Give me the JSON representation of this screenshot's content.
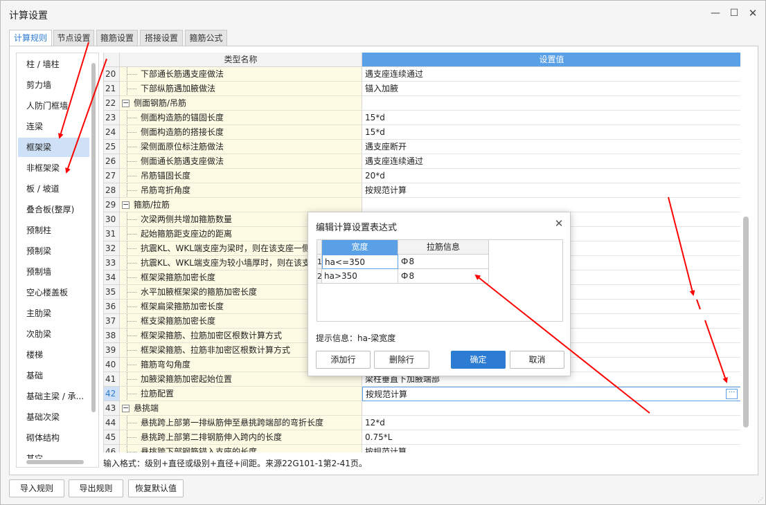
{
  "window": {
    "title": "计算设置",
    "min_glyph": "—",
    "max_glyph": "☐",
    "close_glyph": "✕"
  },
  "tabs": [
    {
      "label": "计算规则",
      "active": true
    },
    {
      "label": "节点设置",
      "active": false
    },
    {
      "label": "箍筋设置",
      "active": false
    },
    {
      "label": "搭接设置",
      "active": false
    },
    {
      "label": "箍筋公式",
      "active": false
    }
  ],
  "sidebar": {
    "items": [
      {
        "label": "柱 / 墙柱",
        "selected": false
      },
      {
        "label": "剪力墙",
        "selected": false
      },
      {
        "label": "人防门框墙",
        "selected": false
      },
      {
        "label": "连梁",
        "selected": false
      },
      {
        "label": "框架梁",
        "selected": true
      },
      {
        "label": "非框架梁",
        "selected": false
      },
      {
        "label": "板 / 坡道",
        "selected": false
      },
      {
        "label": "叠合板(整厚)",
        "selected": false
      },
      {
        "label": "预制柱",
        "selected": false
      },
      {
        "label": "预制梁",
        "selected": false
      },
      {
        "label": "预制墙",
        "selected": false
      },
      {
        "label": "空心楼盖板",
        "selected": false
      },
      {
        "label": "主肋梁",
        "selected": false
      },
      {
        "label": "次肋梁",
        "selected": false
      },
      {
        "label": "楼梯",
        "selected": false
      },
      {
        "label": "基础",
        "selected": false
      },
      {
        "label": "基础主梁 / 承...",
        "selected": false
      },
      {
        "label": "基础次梁",
        "selected": false
      },
      {
        "label": "砌体结构",
        "selected": false
      },
      {
        "label": "其它",
        "selected": false
      }
    ]
  },
  "grid": {
    "col_name": "类型名称",
    "col_value": "设置值",
    "rows": [
      {
        "num": "20",
        "name": "下部通长筋遇支座做法",
        "value": "遇支座连续通过",
        "kind": "child"
      },
      {
        "num": "21",
        "name": "下部纵筋遇加腋做法",
        "value": "锚入加腋",
        "kind": "child"
      },
      {
        "num": "22",
        "name": "侧面钢筋/吊筋",
        "value": "",
        "kind": "group"
      },
      {
        "num": "23",
        "name": "侧面构造筋的锚固长度",
        "value": "15*d",
        "kind": "child"
      },
      {
        "num": "24",
        "name": "侧面构造筋的搭接长度",
        "value": "15*d",
        "kind": "child"
      },
      {
        "num": "25",
        "name": "梁侧面原位标注筋做法",
        "value": "遇支座断开",
        "kind": "child"
      },
      {
        "num": "26",
        "name": "侧面通长筋遇支座做法",
        "value": "遇支座连续通过",
        "kind": "child"
      },
      {
        "num": "27",
        "name": "吊筋锚固长度",
        "value": "20*d",
        "kind": "child"
      },
      {
        "num": "28",
        "name": "吊筋弯折角度",
        "value": "按规范计算",
        "kind": "child"
      },
      {
        "num": "29",
        "name": "箍筋/拉筋",
        "value": "",
        "kind": "group"
      },
      {
        "num": "30",
        "name": "次梁两侧共增加箍筋数量",
        "value": "",
        "kind": "child"
      },
      {
        "num": "31",
        "name": "起始箍筋距支座边的距离",
        "value": "",
        "kind": "child"
      },
      {
        "num": "32",
        "name": "抗震KL、WKL端支座为梁时，则在该支座一侧",
        "value": "",
        "kind": "child"
      },
      {
        "num": "33",
        "name": "抗震KL、WKL端支座为较小墙厚时，则在该支",
        "value": "",
        "kind": "child"
      },
      {
        "num": "34",
        "name": "框架梁箍筋加密长度",
        "value": "",
        "kind": "child"
      },
      {
        "num": "35",
        "name": "水平加腋框架梁的箍筋加密长度",
        "value": "",
        "kind": "child"
      },
      {
        "num": "36",
        "name": "框架扁梁箍筋加密长度",
        "value": "",
        "kind": "child"
      },
      {
        "num": "37",
        "name": "框支梁箍筋加密长度",
        "value": "",
        "kind": "child"
      },
      {
        "num": "38",
        "name": "框架梁箍筋、拉筋加密区根数计算方式",
        "value": "",
        "kind": "child"
      },
      {
        "num": "39",
        "name": "框架梁箍筋、拉筋非加密区根数计算方式",
        "value": "",
        "kind": "child"
      },
      {
        "num": "40",
        "name": "箍筋弯勾角度",
        "value": "",
        "kind": "child"
      },
      {
        "num": "41",
        "name": "加腋梁箍筋加密起始位置",
        "value": "梁柱垂直下加腋端部",
        "kind": "child"
      },
      {
        "num": "42",
        "name": "拉筋配置",
        "value": "按规范计算",
        "kind": "child",
        "current": true
      },
      {
        "num": "43",
        "name": "悬挑端",
        "value": "",
        "kind": "group"
      },
      {
        "num": "44",
        "name": "悬挑跨上部第一排纵筋伸至悬挑跨端部的弯折长度",
        "value": "12*d",
        "kind": "child"
      },
      {
        "num": "45",
        "name": "悬挑跨上部第二排钢筋伸入跨内的长度",
        "value": "0.75*L",
        "kind": "child"
      },
      {
        "num": "46",
        "name": "悬挑跨下部钢筋锚入支座的长度",
        "value": "按规范计算",
        "kind": "child"
      }
    ],
    "expander_glyph": "−",
    "ellipsis_glyph": "···"
  },
  "input_hint": "输入格式：级别+直径或级别+直径+间距。来源22G101-1第2-41页。",
  "bottom_buttons": {
    "import": "导入规则",
    "export": "导出规则",
    "restore": "恢复默认值"
  },
  "modal": {
    "title": "编辑计算设置表达式",
    "close_glyph": "✕",
    "col_a": "宽度",
    "col_b": "拉筋信息",
    "rows": [
      {
        "num": "1",
        "a": "ha<=350",
        "b": "Ф 8"
      },
      {
        "num": "2",
        "a": "ha>350",
        "b": "Ф 8"
      }
    ],
    "hint": "提示信息：ha-梁宽度",
    "add_row": "添加行",
    "delete_row": "删除行",
    "ok": "确定",
    "cancel": "取消"
  },
  "colors": {
    "accent": "#2d7cd3",
    "header_blue": "#5aa0e6",
    "name_cell": "#fdfbe4",
    "arrow": "#ff0000"
  }
}
